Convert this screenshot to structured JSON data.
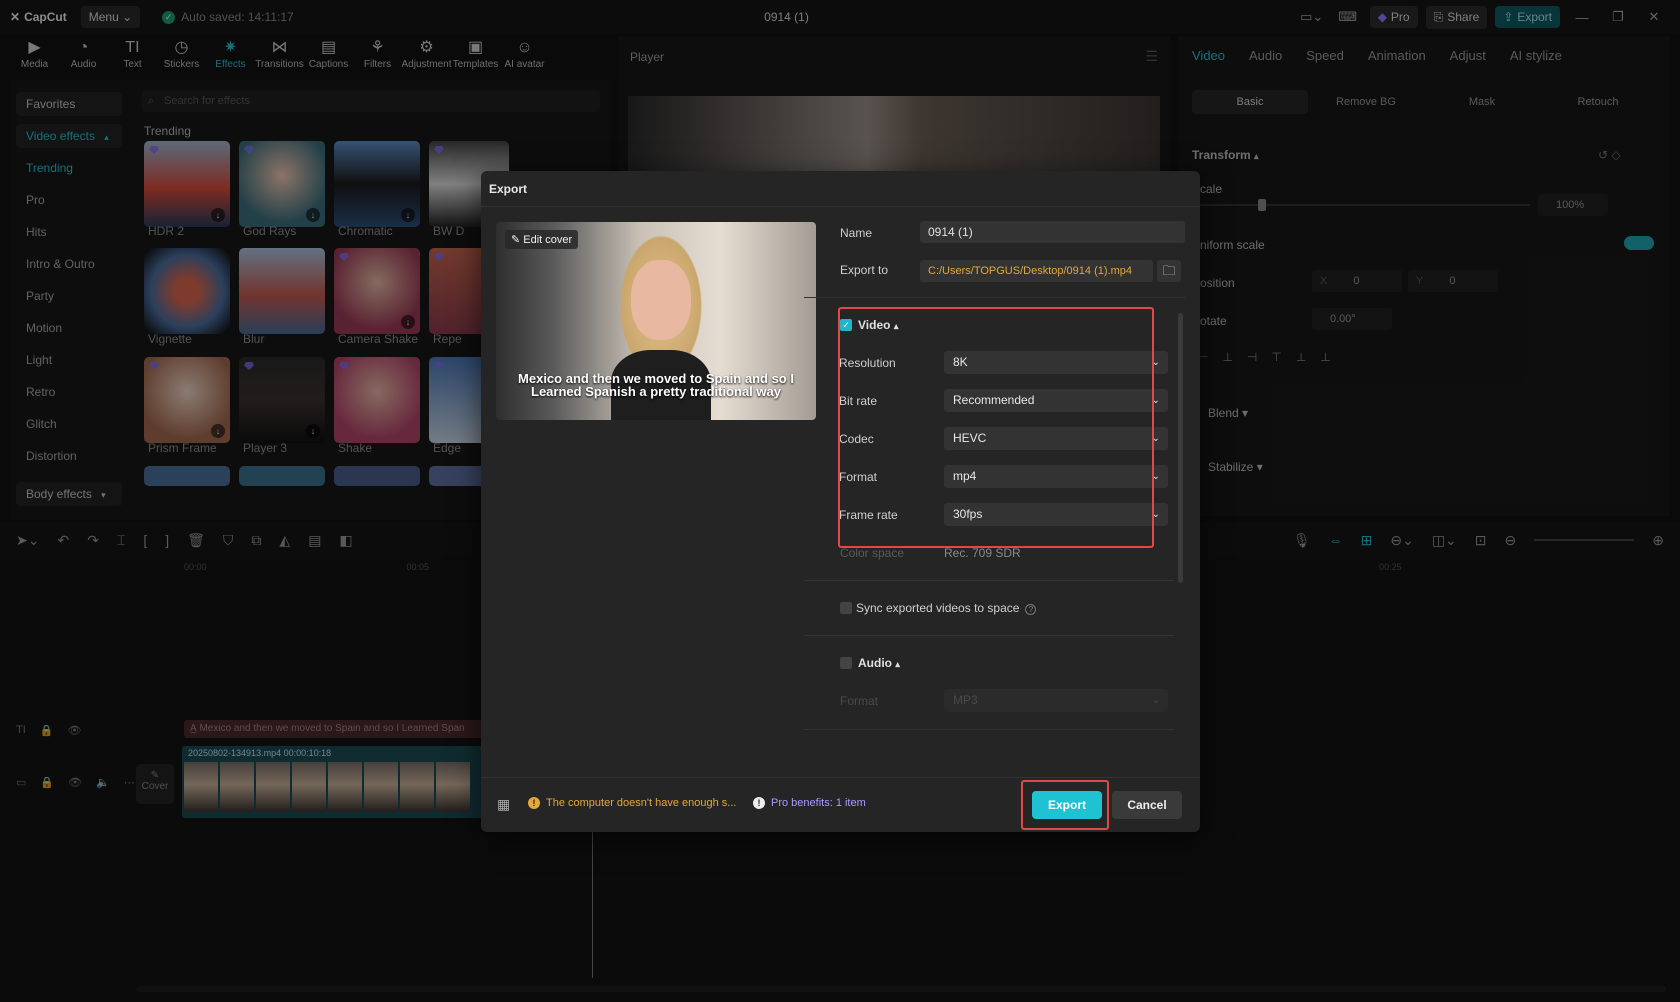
{
  "app": {
    "logo": "CapCut",
    "menu": "Menu",
    "autosave": "Auto saved: 14:11:17",
    "project_title": "0914 (1)",
    "pro": "Pro",
    "share": "Share",
    "export": "Export"
  },
  "toolbar": [
    "Media",
    "Audio",
    "Text",
    "Stickers",
    "Effects",
    "Transitions",
    "Captions",
    "Filters",
    "Adjustment",
    "Templates",
    "AI avatar"
  ],
  "sidebar": {
    "favorites": "Favorites",
    "video_effects": "Video effects",
    "items": [
      "Trending",
      "Pro",
      "Hits",
      "Intro & Outro",
      "Party",
      "Motion",
      "Light",
      "Retro",
      "Glitch",
      "Distortion"
    ],
    "body_effects": "Body effects"
  },
  "effects": {
    "search_placeholder": "Search for effects",
    "section": "Trending",
    "items": [
      "HDR 2",
      "God Rays",
      "Chromatic",
      "BW D",
      "Vignette",
      "Blur",
      "Camera Shake",
      "Repe",
      "Prism Frame",
      "Player 3",
      "Shake",
      "Edge"
    ]
  },
  "player": {
    "title": "Player"
  },
  "inspector": {
    "tabs": [
      "Video",
      "Audio",
      "Speed",
      "Animation",
      "Adjust",
      "AI stylize"
    ],
    "subtabs": [
      "Basic",
      "Remove BG",
      "Mask",
      "Retouch"
    ],
    "transform": "Transform",
    "scale": "cale",
    "scale_value": "100%",
    "uniform_scale": "niform scale",
    "position": "osition",
    "x_label": "X",
    "x_value": "0",
    "y_label": "Y",
    "y_value": "0",
    "rotate": "otate",
    "rotate_value": "0.00°",
    "blend": "Blend",
    "stabilize": "Stabilize"
  },
  "timeline": {
    "ruler": [
      "00:00",
      "00:05",
      "00:25"
    ],
    "text_clip": "Mexico and then we moved to Spain and so I Learned Span",
    "video_clip": "20250802-134913.mp4   00:00:10:18",
    "cover": "Cover"
  },
  "export_dialog": {
    "title": "Export",
    "edit_cover": "Edit cover",
    "caption": "Mexico and then we moved to Spain and so I Learned Spanish a pretty traditional way",
    "name_label": "Name",
    "name_value": "0914 (1)",
    "export_to_label": "Export to",
    "export_to_value": "C:/Users/TOPGUS/Desktop/0914 (1).mp4",
    "video_section": "Video",
    "video_checked": true,
    "settings": [
      {
        "label": "Resolution",
        "value": "8K"
      },
      {
        "label": "Bit rate",
        "value": "Recommended"
      },
      {
        "label": "Codec",
        "value": "HEVC"
      },
      {
        "label": "Format",
        "value": "mp4"
      },
      {
        "label": "Frame rate",
        "value": "30fps"
      }
    ],
    "color_space_label": "Color space",
    "color_space_value": "Rec. 709 SDR",
    "sync_label": "Sync exported videos to space",
    "audio_section": "Audio",
    "audio_format_label": "Format",
    "audio_format_value": "MP3",
    "warning": "The computer doesn't have enough s...",
    "pro_benefits": "Pro benefits: 1 item",
    "export_button": "Export",
    "cancel_button": "Cancel"
  },
  "colors": {
    "accent": "#1fc2d3",
    "highlight": "#e14848",
    "warning": "#e2a93a",
    "pro": "#a99bff"
  }
}
